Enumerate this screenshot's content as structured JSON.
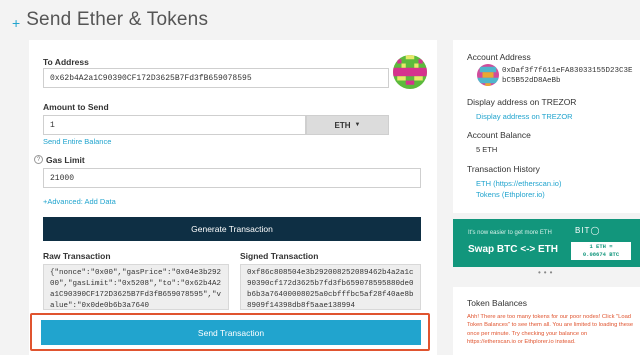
{
  "header": {
    "plus": "+",
    "title": "Send Ether & Tokens"
  },
  "form": {
    "to_label": "To Address",
    "to_value": "0x62b4A2a1C90390CF172D3625B7Fd3fB659078595",
    "amount_label": "Amount to Send",
    "amount_value": "1",
    "unit": "ETH",
    "send_entire": "Send Entire Balance",
    "gas_label": "Gas Limit",
    "gas_value": "21000",
    "advanced": "+Advanced: Add Data",
    "generate_btn": "Generate Transaction",
    "raw_label": "Raw Transaction",
    "raw_value": "{\"nonce\":\"0x00\",\"gasPrice\":\"0x04e3b29200\",\"gasLimit\":\"0x5208\",\"to\":\"0x62b4A2a1C90390CF172D3625B7Fd3fB659078595\",\"value\":\"0x0de0b6b3a7640",
    "signed_label": "Signed Transaction",
    "signed_value": "0xf86c808504e3b292008252089462b4a2a1c90390cf172d3625b7fd3fb659078595880de0b6b3a76400008025a0cbfffbc5af28f40ae8b8909f14398db8f5aae138994",
    "send_btn": "Send Transaction"
  },
  "account": {
    "address_label": "Account Address",
    "address_value": "0xDaf3f7f611eFA83033155D23C3EbC5B52dD8AeBb",
    "trezor_label": "Display address on TREZOR",
    "trezor_link": "Display address on TREZOR",
    "balance_label": "Account Balance",
    "balance_value": "5 ETH",
    "history_label": "Transaction History",
    "history_eth": "ETH (https://etherscan.io)",
    "history_tokens": "Tokens (Ethplorer.io)"
  },
  "banner": {
    "small": "It's now easier to get more ETH",
    "big": "Swap BTC <-> ETH",
    "logo": "BIT◯",
    "rate_line1": "1 ETH =",
    "rate_line2": "0.08674 BTC"
  },
  "tokens": {
    "title": "Token Balances",
    "warning": "Ahh! There are too many tokens for our poor nodes! Click \"Load Token Balances\" to see them all. You are limited to loading these once per minute. Try checking your balance on https://etherscan.io or Ethplorer.io instead."
  },
  "colors": {
    "accent": "#21a4ce",
    "navy": "#0e2f44",
    "highlight": "#e0542f",
    "banner": "#12967c"
  }
}
